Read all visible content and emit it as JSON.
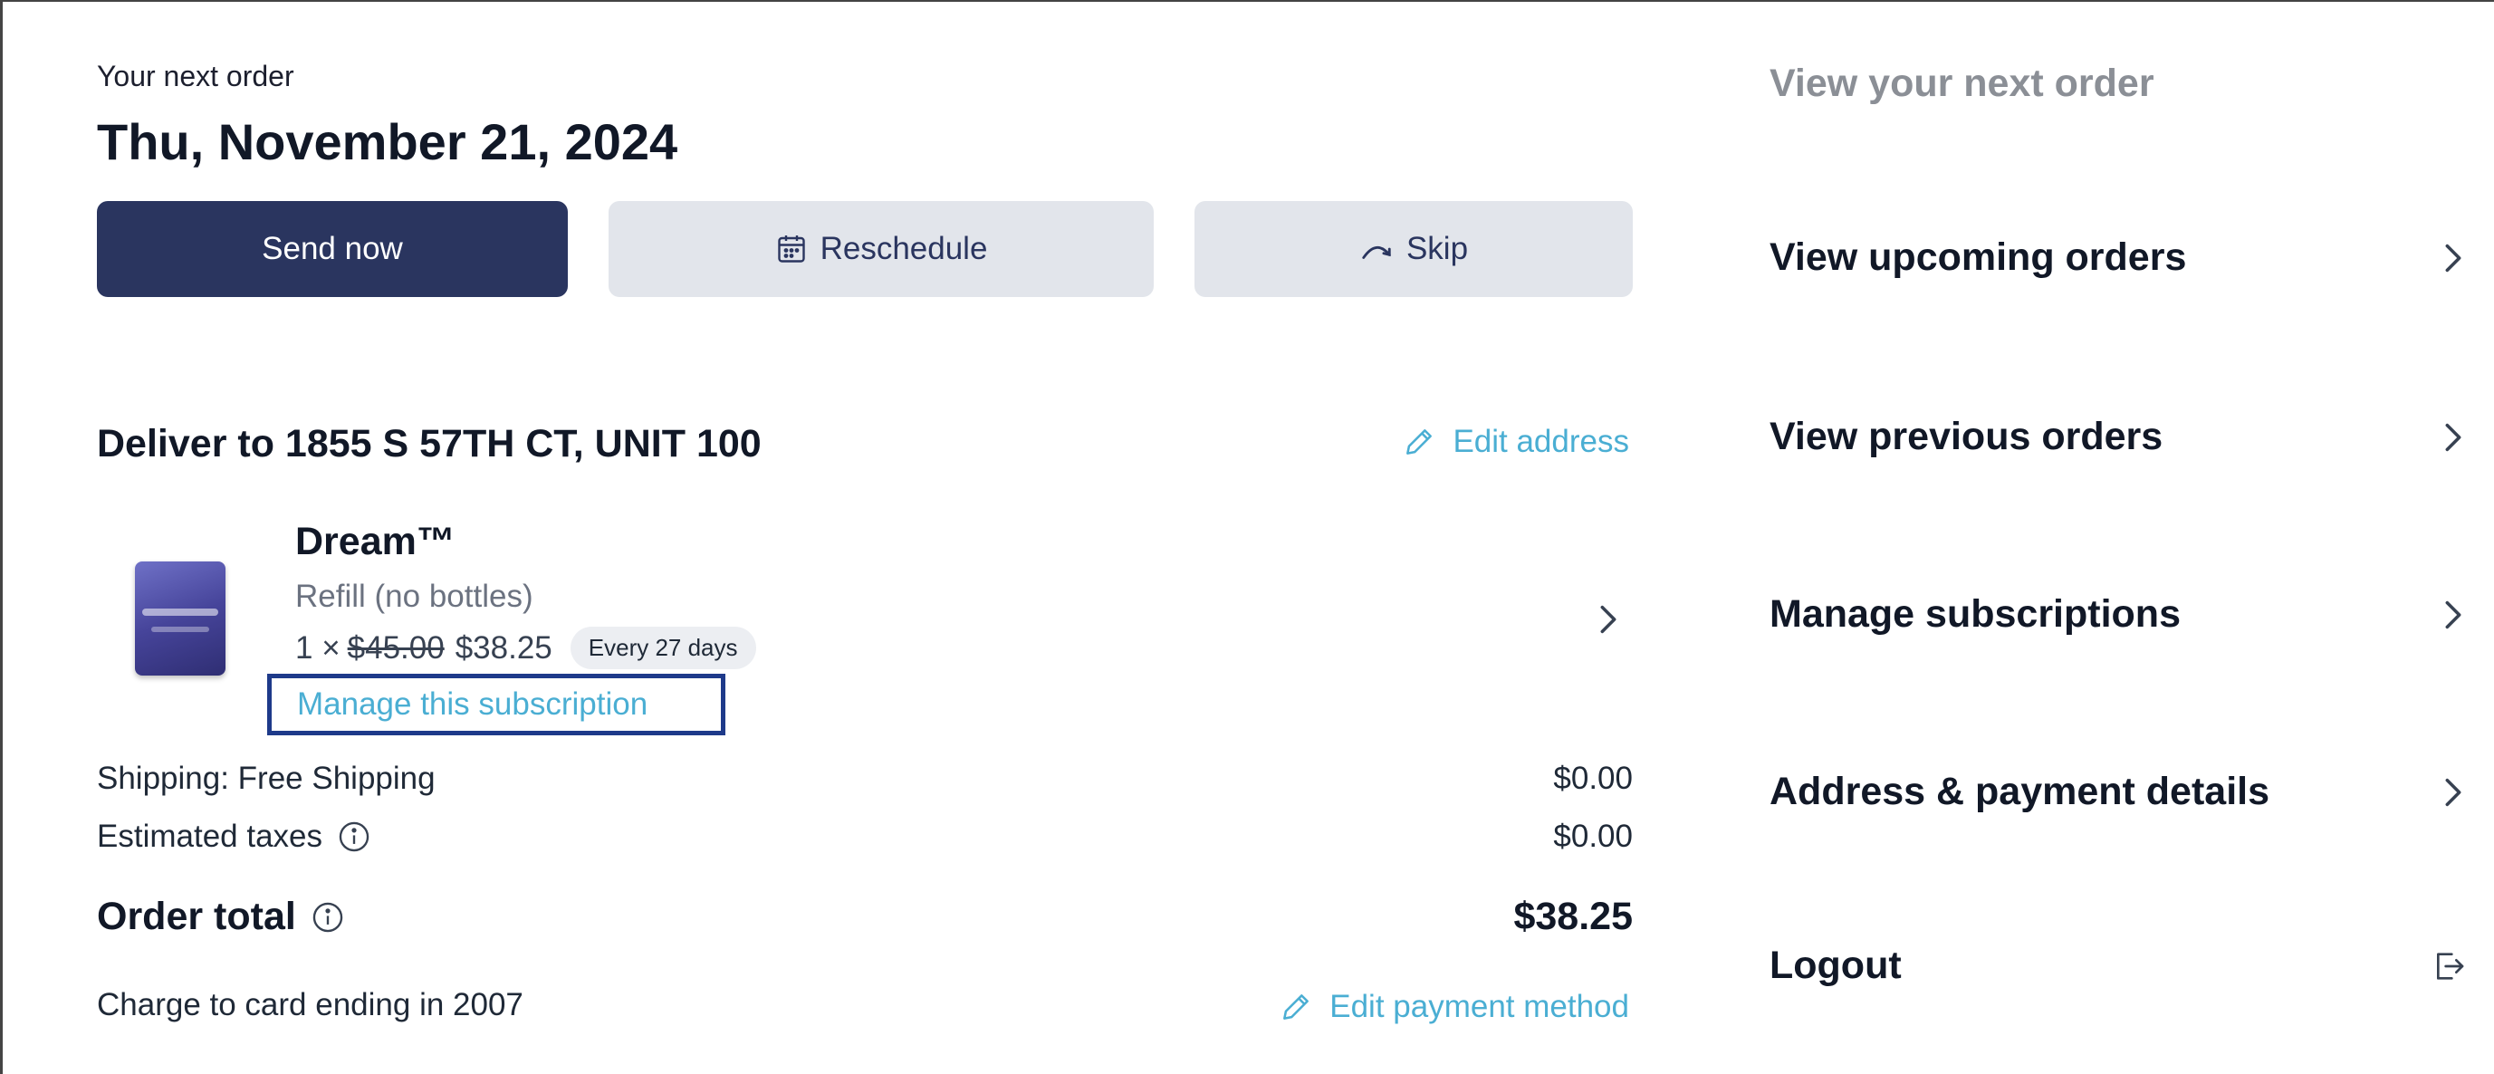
{
  "order": {
    "next_label": "Your next order",
    "date": "Thu, November 21, 2024",
    "actions": {
      "send_now": "Send now",
      "reschedule": "Reschedule",
      "skip": "Skip"
    },
    "deliver_to": "Deliver to 1855 S 57TH CT, UNIT 100",
    "edit_address": "Edit address"
  },
  "product": {
    "name": "Dream™",
    "variant": "Refill (no bottles)",
    "quantity": "1 ×",
    "original_price": "$45.00",
    "price": "$38.25",
    "frequency": "Every 27 days",
    "manage_link": "Manage this subscription"
  },
  "summary": {
    "shipping_label": "Shipping: Free Shipping",
    "shipping_value": "$0.00",
    "taxes_label": "Estimated taxes",
    "taxes_value": "$0.00",
    "total_label": "Order total",
    "total_value": "$38.25",
    "charge_text": "Charge to card ending in 2007",
    "edit_payment": "Edit payment method"
  },
  "sidebar": {
    "title": "View your next order",
    "items": [
      {
        "label": "View upcoming orders",
        "icon": "chevron-right-icon"
      },
      {
        "label": "View previous orders",
        "icon": "chevron-right-icon"
      },
      {
        "label": "Manage subscriptions",
        "icon": "chevron-right-icon"
      },
      {
        "label": "Address & payment details",
        "icon": "chevron-right-icon"
      },
      {
        "label": "Logout",
        "icon": "logout-icon"
      }
    ]
  },
  "colors": {
    "primary": "#2a355f",
    "secondary_bg": "#e2e5eb",
    "link": "#4aaed3",
    "highlight_border": "#1e3a8a"
  }
}
